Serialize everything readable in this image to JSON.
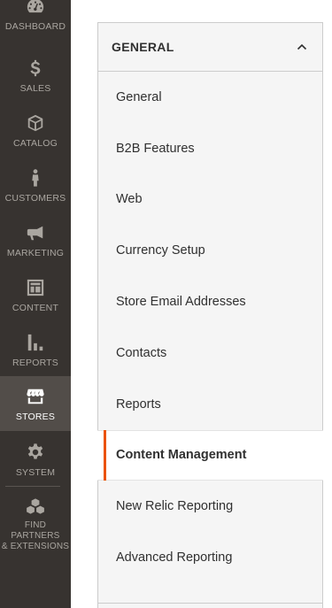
{
  "nav": {
    "items": [
      {
        "label": "DASHBOARD",
        "icon": "dashboard-icon"
      },
      {
        "label": "SALES",
        "icon": "dollar-icon"
      },
      {
        "label": "CATALOG",
        "icon": "cube-icon"
      },
      {
        "label": "CUSTOMERS",
        "icon": "person-icon"
      },
      {
        "label": "MARKETING",
        "icon": "megaphone-icon"
      },
      {
        "label": "CONTENT",
        "icon": "layout-icon"
      },
      {
        "label": "REPORTS",
        "icon": "bar-chart-icon"
      },
      {
        "label": "STORES",
        "icon": "storefront-icon",
        "active": true
      },
      {
        "label": "SYSTEM",
        "icon": "gear-icon"
      },
      {
        "label": "FIND PARTNERS\n& EXTENSIONS",
        "icon": "boxes-icon"
      }
    ]
  },
  "panel": {
    "title": "GENERAL",
    "tabs": [
      {
        "label": "General"
      },
      {
        "label": "B2B Features"
      },
      {
        "label": "Web"
      },
      {
        "label": "Currency Setup"
      },
      {
        "label": "Store Email Addresses"
      },
      {
        "label": "Contacts"
      },
      {
        "label": "Reports"
      },
      {
        "label": "Content Management",
        "active": true
      },
      {
        "label": "New Relic Reporting"
      },
      {
        "label": "Advanced Reporting"
      }
    ]
  },
  "colors": {
    "nav_bg": "#373330",
    "nav_active_bg": "#524d49",
    "accent": "#eb5202",
    "panel_bg": "#f5f5f5"
  }
}
